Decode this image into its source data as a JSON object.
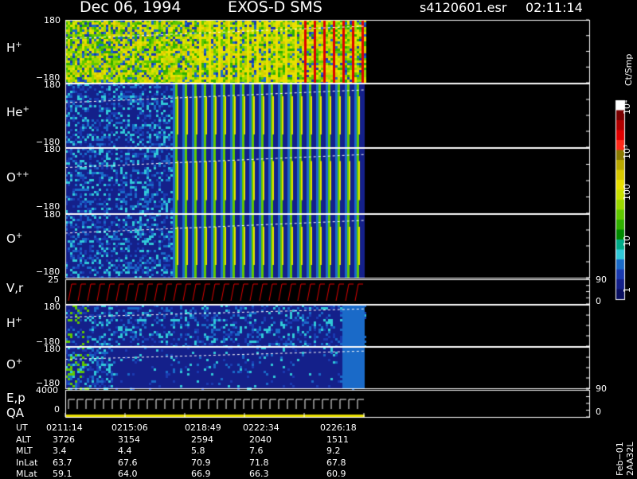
{
  "header": {
    "date": "Dec 06, 1994",
    "instrument": "EXOS-D SMS",
    "file": "s4120601.esr",
    "time": "02:11:14"
  },
  "panels": [
    {
      "id": "h_plus_1",
      "species": "H",
      "charge": "+",
      "ytop": "180",
      "ybot": "−180"
    },
    {
      "id": "he_plus",
      "species": "He",
      "charge": "+",
      "ytop": "180",
      "ybot": "−180"
    },
    {
      "id": "o_pp",
      "species": "O",
      "charge": "++",
      "ytop": "180",
      "ybot": "−180"
    },
    {
      "id": "o_plus_1",
      "species": "O",
      "charge": "+",
      "ytop": "180",
      "ybot": "−180"
    },
    {
      "id": "vr",
      "species": "V,r",
      "charge": "",
      "ytop": "25",
      "ybot": "0",
      "rtop": "90",
      "rbot": "0"
    },
    {
      "id": "h_plus_2",
      "species": "H",
      "charge": "+",
      "ytop": "180",
      "ybot": "−180"
    },
    {
      "id": "o_plus_2",
      "species": "O",
      "charge": "+",
      "ytop": "180",
      "ybot": "−180"
    },
    {
      "id": "ep",
      "species": "E,p",
      "charge": "",
      "ytop": "4000",
      "ybot": "0",
      "rtop": "90",
      "rbot": "0"
    }
  ],
  "qa_label": "QA",
  "colorbar": {
    "unit": "Ct/Smp",
    "ticks": [
      "10⁴",
      "10³",
      "100",
      "10",
      "1"
    ],
    "colors": [
      "#ffffff",
      "#7a0000",
      "#b00000",
      "#e00000",
      "#ff2a1a",
      "#8a7a00",
      "#b9a800",
      "#d8c800",
      "#e9e000",
      "#c8e000",
      "#9ad800",
      "#60c800",
      "#30b000",
      "#008a00",
      "#00aa88",
      "#30c8d8",
      "#1a6ac8",
      "#1a3ab0",
      "#14208a",
      "#0a1060"
    ]
  },
  "ephemeris": {
    "rows": [
      {
        "label": "UT",
        "values": [
          "0211:14",
          "0215:06",
          "0218:49",
          "0222:34",
          "0226:18"
        ]
      },
      {
        "label": "ALT",
        "values": [
          "3726",
          "3154",
          "2594",
          "2040",
          "1511"
        ]
      },
      {
        "label": "MLT",
        "values": [
          "3.4",
          "4.4",
          "5.8",
          "7.6",
          "9.2"
        ]
      },
      {
        "label": "InLat",
        "values": [
          "63.7",
          "67.6",
          "70.9",
          "71.8",
          "67.8"
        ]
      },
      {
        "label": "MLat",
        "values": [
          "59.1",
          "64.0",
          "66.9",
          "66.3",
          "60.9"
        ]
      }
    ]
  },
  "footer_stamp": "Feb−01 2AA32L",
  "chart_data": {
    "type": "heatmap",
    "title": "Dec 06, 1994   EXOS-D SMS",
    "xlabel": "UT",
    "x_ticks": [
      "0211:14",
      "0215:06",
      "0218:49",
      "0222:34",
      "0226:18"
    ],
    "color_scale": "log",
    "color_range": [
      1,
      10000
    ],
    "color_unit": "Ct/Smp",
    "panels": [
      {
        "name": "H+",
        "ylim": [
          -180,
          180
        ]
      },
      {
        "name": "He+",
        "ylim": [
          -180,
          180
        ]
      },
      {
        "name": "O++",
        "ylim": [
          -180,
          180
        ]
      },
      {
        "name": "O+",
        "ylim": [
          -180,
          180
        ]
      },
      {
        "name": "V,r",
        "ylim": [
          0,
          25
        ],
        "y2lim": [
          0,
          90
        ]
      },
      {
        "name": "H+",
        "ylim": [
          -180,
          180
        ]
      },
      {
        "name": "O+",
        "ylim": [
          -180,
          180
        ]
      },
      {
        "name": "E,p",
        "ylim": [
          0,
          4000
        ],
        "y2lim": [
          0,
          90
        ]
      }
    ]
  }
}
